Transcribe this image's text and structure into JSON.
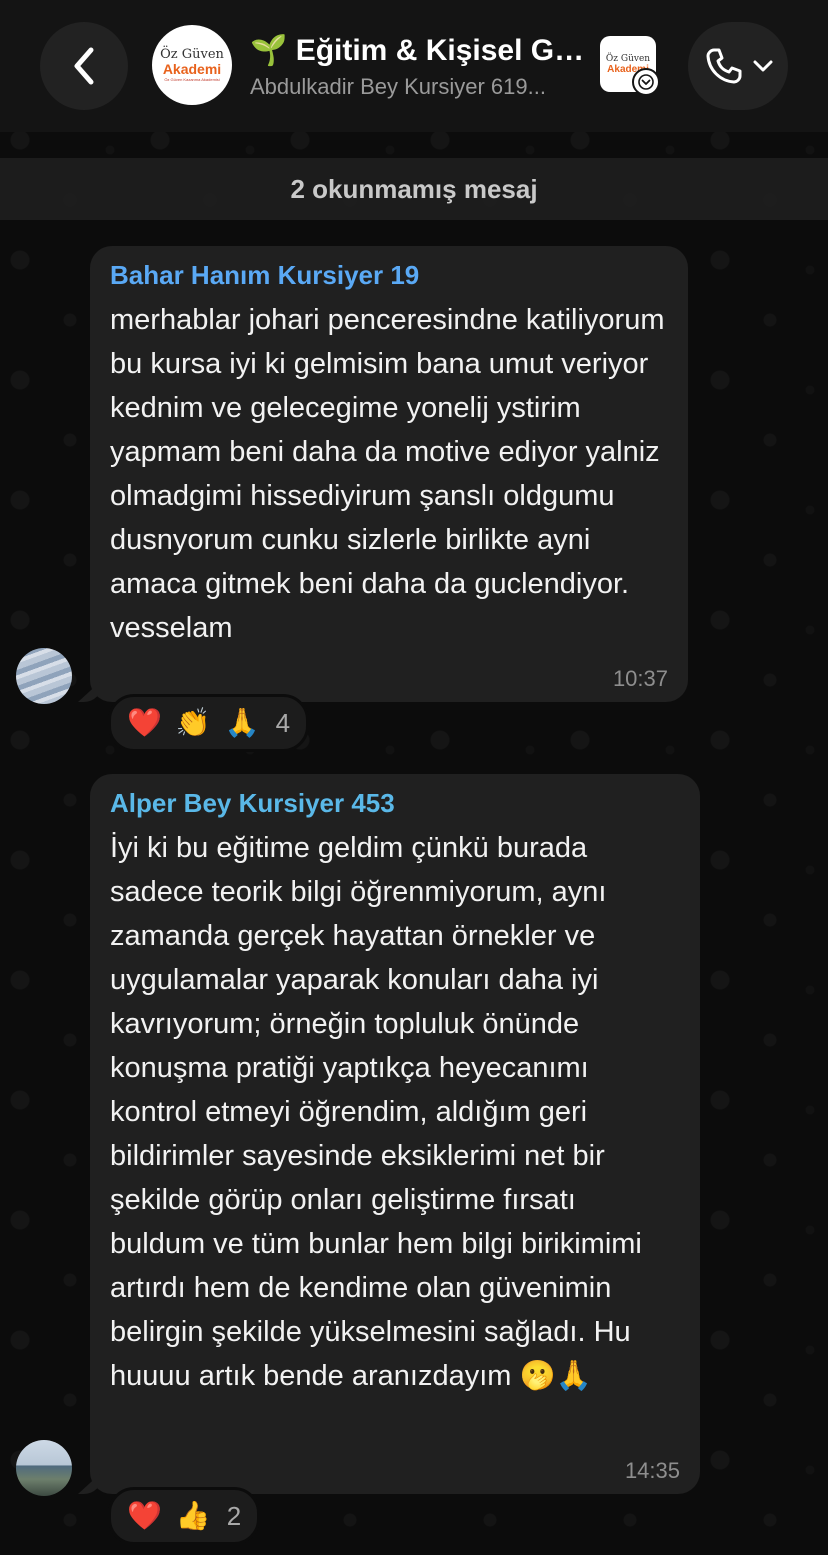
{
  "header": {
    "back_label": "",
    "chat_title": "🌱 Eğitim & Kişisel Geli...",
    "chat_subtitle": "Abdulkadir Bey Kursiyer 619...",
    "logo": {
      "line1": "Öz Güven",
      "line2": "Akademi",
      "line3": "Öz Güven Kazanma Akademisi"
    },
    "icons": {
      "back": "chevron-left-icon",
      "call": "phone-icon",
      "call_menu": "chevron-down-icon",
      "community_check": "checkmark-icon"
    }
  },
  "unread_banner": "2 okunmamış mesaj",
  "messages": [
    {
      "sender": "Bahar Hanım Kursiyer 19",
      "sender_color": "#5aa9f5",
      "text": "merhablar johari penceresindne katiliyorum bu kursa iyi ki gelmisim bana umut veriyor kednim ve gelecegime yonelij ystirim yapmam beni daha da motive ediyor yalniz olmadgimi hissediyirum  şanslı oldgumu dusnyorum cunku sizlerle birlikte ayni amaca gitmek beni daha da guclendiyor. vesselam",
      "time": "10:37",
      "reactions": [
        "❤️",
        "👏",
        "🙏"
      ],
      "reaction_count": "4"
    },
    {
      "sender": "Alper Bey Kursiyer 453",
      "sender_color": "#5ab8e8",
      "text": "İyi ki bu eğitime geldim çünkü burada sadece teorik bilgi öğrenmiyorum, aynı zamanda gerçek hayattan örnekler ve uygulamalar yaparak konuları daha iyi kavrıyorum; örneğin topluluk önünde konuşma pratiği yaptıkça heyecanımı kontrol etmeyi öğrendim, aldığım geri bildirimler sayesinde eksiklerimi net bir şekilde görüp onları geliştirme fırsatı buldum ve tüm bunlar hem bilgi birikimimi artırdı hem de kendime olan güvenimin belirgin şekilde yükselmesini sağladı. Hu huuuu artık bende aranızdayım 🫢🙏",
      "time": "14:35",
      "reactions": [
        "❤️",
        "👍"
      ],
      "reaction_count": "2"
    }
  ]
}
